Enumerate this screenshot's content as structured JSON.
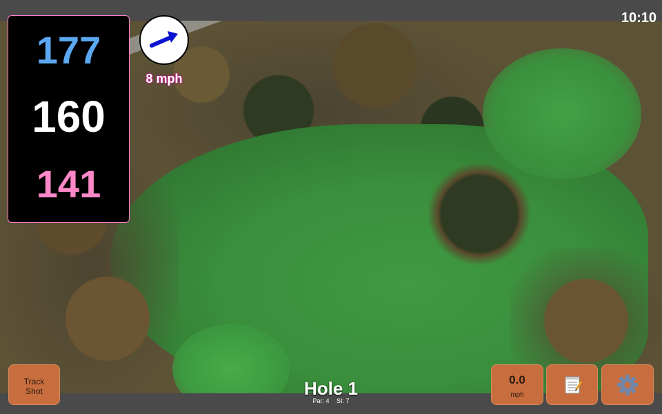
{
  "status": {
    "time": "10:10"
  },
  "distances": {
    "back": "177",
    "middle": "160",
    "front": "141"
  },
  "wind": {
    "speed": "8 mph",
    "direction_icon": "arrow-icon"
  },
  "buttons": {
    "track_shot_line1": "Track",
    "track_shot_line2": "Shot",
    "swing_speed_value": "0.0",
    "swing_speed_unit": "mph",
    "notes_icon": "notepad-icon",
    "settings_icon": "gear-icon"
  },
  "hole": {
    "title": "Hole 1",
    "par": "Par: 4",
    "si": "SI: 7"
  },
  "colors": {
    "back": "#5aa8f0",
    "middle": "#ffffff",
    "front": "#ff88c8",
    "button": "#c86e3e",
    "panel_border": "#ff7fd0"
  }
}
